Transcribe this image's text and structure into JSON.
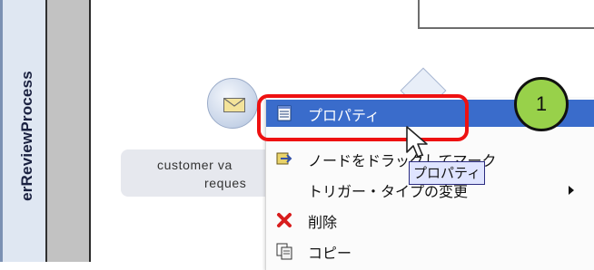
{
  "lane": {
    "label": "erReviewProcess"
  },
  "task": {
    "line1": "customer va",
    "line2": "reques"
  },
  "context_menu": {
    "items": [
      {
        "label": "プロパティ",
        "icon": "properties-icon",
        "selected": true
      },
      {
        "label": "ノードをドラッグしてマーク",
        "icon": "drag-mark-icon"
      },
      {
        "label": "トリガー・タイプの変更",
        "icon": "",
        "has_submenu": true
      },
      {
        "label": "削除",
        "icon": "delete-icon"
      },
      {
        "label": "コピー",
        "icon": "copy-icon"
      }
    ]
  },
  "tooltip": {
    "text": "プロパティ"
  },
  "step_badge": {
    "number": "1"
  },
  "colors": {
    "selection": "#3a6ccb",
    "highlight_box": "#ee1111",
    "badge": "#98d14a",
    "tooltip_bg": "#dfe4ff"
  }
}
